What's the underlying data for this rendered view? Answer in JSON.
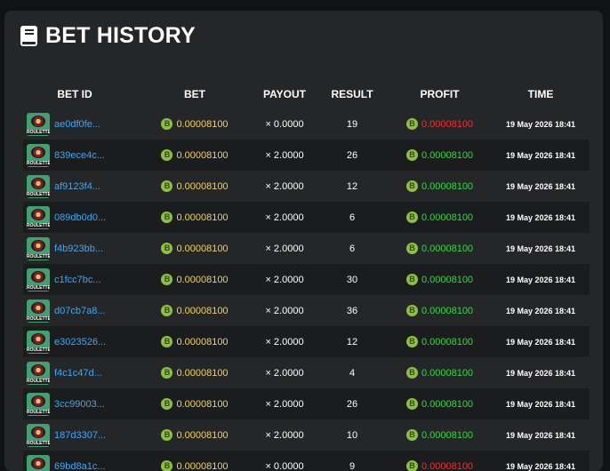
{
  "title": "BET HISTORY",
  "columns": {
    "bet_id": "BET ID",
    "bet": "BET",
    "payout": "PAYOUT",
    "result": "RESULT",
    "profit": "PROFIT",
    "time": "TIME"
  },
  "game_icon_label": "ROULETTE",
  "coin_symbol": "B",
  "colors": {
    "bet_id": "#3fa9f5",
    "bet_amount": "#f5d35c",
    "profit_win": "#37d84a",
    "profit_loss": "#ee2f2f",
    "coin": "#8cc13f"
  },
  "rows": [
    {
      "id": "ae0df0fe...",
      "bet": "0.00008100",
      "payout": "× 0.0000",
      "result": "19",
      "profit": "0.00008100",
      "win": false,
      "time": "19 May 2026 18:41"
    },
    {
      "id": "839ece4c...",
      "bet": "0.00008100",
      "payout": "× 2.0000",
      "result": "26",
      "profit": "0.00008100",
      "win": true,
      "time": "19 May 2026 18:41"
    },
    {
      "id": "af9123f4...",
      "bet": "0.00008100",
      "payout": "× 2.0000",
      "result": "12",
      "profit": "0.00008100",
      "win": true,
      "time": "19 May 2026 18:41"
    },
    {
      "id": "089db0d0...",
      "bet": "0.00008100",
      "payout": "× 2.0000",
      "result": "6",
      "profit": "0.00008100",
      "win": true,
      "time": "19 May 2026 18:41"
    },
    {
      "id": "f4b923bb...",
      "bet": "0.00008100",
      "payout": "× 2.0000",
      "result": "6",
      "profit": "0.00008100",
      "win": true,
      "time": "19 May 2026 18:41"
    },
    {
      "id": "c1fcc7bc...",
      "bet": "0.00008100",
      "payout": "× 2.0000",
      "result": "30",
      "profit": "0.00008100",
      "win": true,
      "time": "19 May 2026 18:41"
    },
    {
      "id": "d07cb7a8...",
      "bet": "0.00008100",
      "payout": "× 2.0000",
      "result": "36",
      "profit": "0.00008100",
      "win": true,
      "time": "19 May 2026 18:41"
    },
    {
      "id": "e3023526...",
      "bet": "0.00008100",
      "payout": "× 2.0000",
      "result": "12",
      "profit": "0.00008100",
      "win": true,
      "time": "19 May 2026 18:41"
    },
    {
      "id": "f4c1c47d...",
      "bet": "0.00008100",
      "payout": "× 2.0000",
      "result": "4",
      "profit": "0.00008100",
      "win": true,
      "time": "19 May 2026 18:41"
    },
    {
      "id": "3cc99003...",
      "bet": "0.00008100",
      "payout": "× 2.0000",
      "result": "26",
      "profit": "0.00008100",
      "win": true,
      "time": "19 May 2026 18:41"
    },
    {
      "id": "187d3307...",
      "bet": "0.00008100",
      "payout": "× 2.0000",
      "result": "10",
      "profit": "0.00008100",
      "win": true,
      "time": "19 May 2026 18:41"
    },
    {
      "id": "69bd8a1c...",
      "bet": "0.00008100",
      "payout": "× 0.0000",
      "result": "9",
      "profit": "0.00008100",
      "win": false,
      "time": "19 May 2026 18:41"
    }
  ]
}
